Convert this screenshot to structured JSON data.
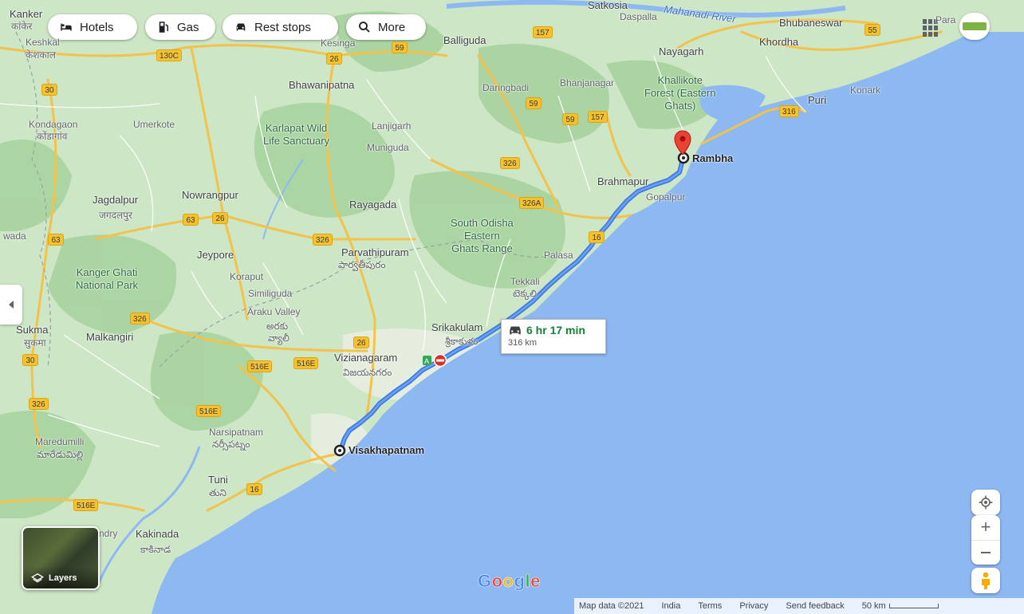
{
  "colors": {
    "land": "#c9e4c0",
    "forest": "#a7d19e",
    "sea": "#8db8f2",
    "route": "#4c83e8",
    "road": "#f3c24a",
    "pin": "#ea4335",
    "green_text": "#188038"
  },
  "chips": [
    {
      "icon": "bed-icon",
      "label": "Hotels"
    },
    {
      "icon": "gas-pump-icon",
      "label": "Gas"
    },
    {
      "icon": "car-icon",
      "label": "Rest stops"
    },
    {
      "icon": "search-icon",
      "label": "More"
    }
  ],
  "route": {
    "origin": "Visakhapatnam",
    "destination": "Rambha",
    "duration": "6 hr 17 min",
    "distance": "316 km"
  },
  "places": {
    "kanker": "Kanker",
    "kanker_te": "कांकेर",
    "satkosia": "Satkosia",
    "dasapalla": "Daspalla",
    "bhubaneswar": "Bhubaneswar",
    "para": "Para",
    "mahanadi": "Mahanadi River",
    "keshkal": "Keshkal",
    "keshkal_te": "केशकाल",
    "kesinga": "Kesinga",
    "balliguda": "Balliguda",
    "khordha": "Khordha",
    "nayagarh": "Nayagarh",
    "bhawanipatna": "Bhawanipatna",
    "daringbadi": "Daringbadi",
    "bhanjanagar": "Bhanjanagar",
    "khallikote": "Khallikote\nForest (Eastern\nGhats)",
    "puri": "Puri",
    "konark": "Konark",
    "kondagaon": "Kondagaon",
    "kondagaon_te": "कोंडागांव",
    "umerkote": "Umerkote",
    "karlapat": "Karlapat Wild\nLife Sanctuary",
    "lanjigarh": "Lanjigarh",
    "muniguda": "Muniguda",
    "jagdalpur": "Jagdalpur",
    "jagdalpur_te": "जगदलपुर",
    "nowrangpur": "Nowrangpur",
    "rayagada": "Rayagada",
    "brahmapur": "Brahmapur",
    "gopalpur": "Gopalpur",
    "wada": "wada",
    "southodisha": "South Odisha\nEastern\nGhats Range",
    "jeypore": "Jeypore",
    "parvathipuram": "Parvathipuram",
    "parvathipuram_te": "పార్వతీపురం",
    "kangerghati": "Kanger Ghati\nNational Park",
    "koraput": "Koraput",
    "palasa": "Palasa",
    "similiguda": "Similiguda",
    "tekkali": "Tekkali",
    "tekkali_te": "టెక్కలి",
    "arakuvalley": "Araku Valley",
    "araku_te": "అరకు",
    "araku_te2": "వ్యాలీ",
    "sukma": "Sukma",
    "sukma_te": "सुकमा",
    "malkangiri": "Malkangiri",
    "srikakulam": "Srikakulam",
    "srikakulam_te": "శ్రీకాకుళం",
    "vizianagaram": "Vizianagaram",
    "vizianagaram_te": "విజయనగరం",
    "maredumilli": "Maredumilli",
    "maredumilli_te": "మారేడుమిల్లి",
    "narsipatnam": "Narsipatnam",
    "narsipatnam_te": "నర్సీపట్నం",
    "tuni": "Tuni",
    "tuni_te": "తుని",
    "kakinada": "Kakinada",
    "kakinada_te": "కాకినాడ",
    "ndry": "ndry"
  },
  "shields": [
    "130C",
    "26",
    "59",
    "157",
    "55",
    "30",
    "59",
    "59",
    "157",
    "316",
    "326",
    "63",
    "26",
    "63",
    "326A",
    "326",
    "16",
    "326",
    "26",
    "30",
    "516E",
    "516E",
    "326",
    "516E",
    "16",
    "516E"
  ],
  "layers_label": "Layers",
  "footer": {
    "mapdata": "Map data ©2021",
    "india": "India",
    "terms": "Terms",
    "privacy": "Privacy",
    "feedback": "Send feedback",
    "scale": "50 km"
  },
  "google": "Google"
}
